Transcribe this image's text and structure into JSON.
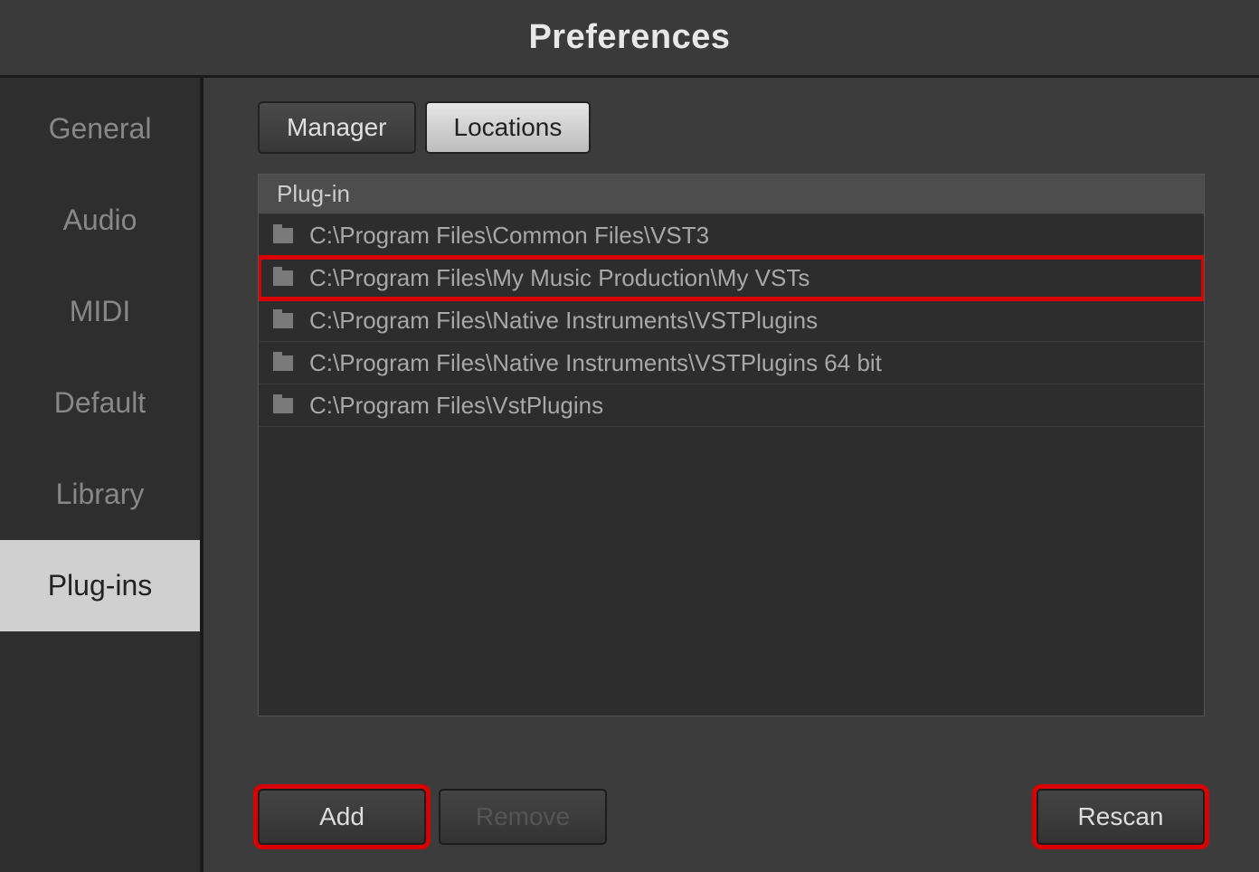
{
  "window": {
    "title": "Preferences"
  },
  "sidebar": {
    "items": [
      {
        "label": "General",
        "active": false
      },
      {
        "label": "Audio",
        "active": false
      },
      {
        "label": "MIDI",
        "active": false
      },
      {
        "label": "Default",
        "active": false
      },
      {
        "label": "Library",
        "active": false
      },
      {
        "label": "Plug-ins",
        "active": true
      }
    ]
  },
  "tabs": {
    "manager": "Manager",
    "locations": "Locations",
    "active": "locations"
  },
  "list": {
    "header": "Plug-in",
    "rows": [
      {
        "path": "C:\\Program Files\\Common Files\\VST3",
        "highlighted": false
      },
      {
        "path": "C:\\Program Files\\My Music Production\\My VSTs",
        "highlighted": true
      },
      {
        "path": "C:\\Program Files\\Native Instruments\\VSTPlugins",
        "highlighted": false
      },
      {
        "path": "C:\\Program Files\\Native Instruments\\VSTPlugins 64 bit",
        "highlighted": false
      },
      {
        "path": "C:\\Program Files\\VstPlugins",
        "highlighted": false
      }
    ]
  },
  "buttons": {
    "add": "Add",
    "remove": "Remove",
    "rescan": "Rescan"
  }
}
